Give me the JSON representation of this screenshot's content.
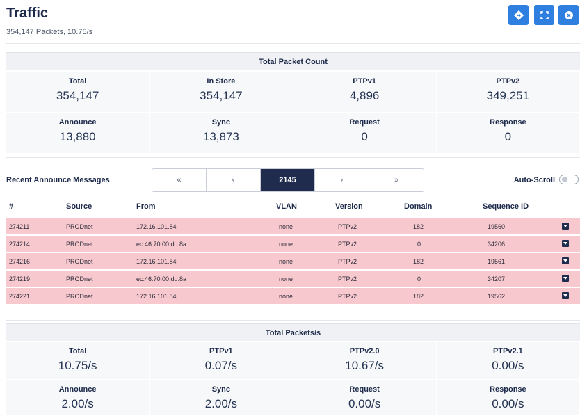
{
  "header": {
    "title": "Traffic",
    "subtitle": "354,147 Packets, 10.75/s",
    "buttons": {
      "goto": "goto-icon",
      "fullscreen": "fullscreen-icon",
      "close": "close-icon"
    }
  },
  "packet_count": {
    "heading": "Total Packet Count",
    "row1": [
      {
        "label": "Total",
        "value": "354,147"
      },
      {
        "label": "In Store",
        "value": "354,147"
      },
      {
        "label": "PTPv1",
        "value": "4,896"
      },
      {
        "label": "PTPv2",
        "value": "349,251"
      }
    ],
    "row2": [
      {
        "label": "Announce",
        "value": "13,880"
      },
      {
        "label": "Sync",
        "value": "13,873"
      },
      {
        "label": "Request",
        "value": "0"
      },
      {
        "label": "Response",
        "value": "0"
      }
    ]
  },
  "recent": {
    "label": "Recent Announce Messages",
    "pager": {
      "first": "«",
      "prev": "‹",
      "current": "2145",
      "next": "›",
      "last": "»"
    },
    "autoscroll_label": "Auto-Scroll",
    "autoscroll_on": false,
    "columns": {
      "num": "#",
      "source": "Source",
      "from": "From",
      "vlan": "VLAN",
      "version": "Version",
      "domain": "Domain",
      "seq": "Sequence ID"
    },
    "rows": [
      {
        "num": "274211",
        "source": "PRODnet",
        "from": "172.16.101.84",
        "vlan": "none",
        "version": "PTPv2",
        "domain": "182",
        "seq": "19560"
      },
      {
        "num": "274214",
        "source": "PRODnet",
        "from": "ec:46:70:00:dd:8a",
        "vlan": "none",
        "version": "PTPv2",
        "domain": "0",
        "seq": "34206"
      },
      {
        "num": "274216",
        "source": "PRODnet",
        "from": "172.16.101.84",
        "vlan": "none",
        "version": "PTPv2",
        "domain": "182",
        "seq": "19561"
      },
      {
        "num": "274219",
        "source": "PRODnet",
        "from": "ec:46:70:00:dd:8a",
        "vlan": "none",
        "version": "PTPv2",
        "domain": "0",
        "seq": "34207"
      },
      {
        "num": "274221",
        "source": "PRODnet",
        "from": "172.16.101.84",
        "vlan": "none",
        "version": "PTPv2",
        "domain": "182",
        "seq": "19562"
      }
    ]
  },
  "packets_per_sec": {
    "heading": "Total Packets/s",
    "row1": [
      {
        "label": "Total",
        "value": "10.75/s"
      },
      {
        "label": "PTPv1",
        "value": "0.07/s"
      },
      {
        "label": "PTPv2.0",
        "value": "10.67/s"
      },
      {
        "label": "PTPv2.1",
        "value": "0.00/s"
      }
    ],
    "row2": [
      {
        "label": "Announce",
        "value": "2.00/s"
      },
      {
        "label": "Sync",
        "value": "2.00/s"
      },
      {
        "label": "Request",
        "value": "0.00/s"
      },
      {
        "label": "Response",
        "value": "0.00/s"
      }
    ]
  },
  "colors": {
    "accent": "#2f7fe0",
    "row_highlight": "#f7c8cd",
    "pager_active": "#1f2c4d"
  }
}
